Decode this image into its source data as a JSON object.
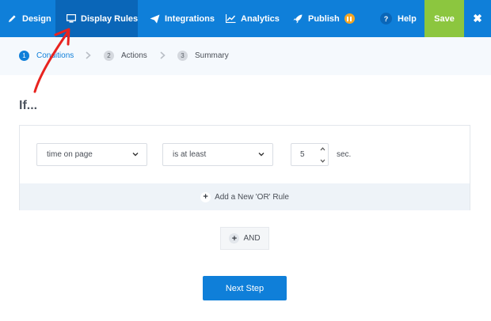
{
  "nav": {
    "design": "Design",
    "display_rules": "Display Rules",
    "integrations": "Integrations",
    "analytics": "Analytics",
    "publish": "Publish",
    "help": "Help",
    "help_glyph": "?",
    "save": "Save",
    "close_glyph": "✖",
    "active_tab": "Display Rules",
    "colors": {
      "bar": "#0f7fd9",
      "active": "#0a66b8",
      "save": "#8cc63f",
      "badge": "#f5a623"
    }
  },
  "steps": [
    {
      "num": "1",
      "label": "Conditions",
      "active": true
    },
    {
      "num": "2",
      "label": "Actions",
      "active": false
    },
    {
      "num": "3",
      "label": "Summary",
      "active": false
    }
  ],
  "rules": {
    "heading": "If...",
    "metric": "time on page",
    "operator": "is at least",
    "value": "5",
    "unit": "sec.",
    "add_or": "Add a New 'OR' Rule",
    "and": "AND"
  },
  "next_step": "Next Step",
  "icons": {
    "design": "pencil-icon",
    "display_rules": "monitor-icon",
    "integrations": "paper-plane-icon",
    "analytics": "line-chart-icon",
    "publish": "rocket-icon",
    "publish_badge": "pause-icon",
    "help": "question-icon",
    "close": "close-icon"
  }
}
